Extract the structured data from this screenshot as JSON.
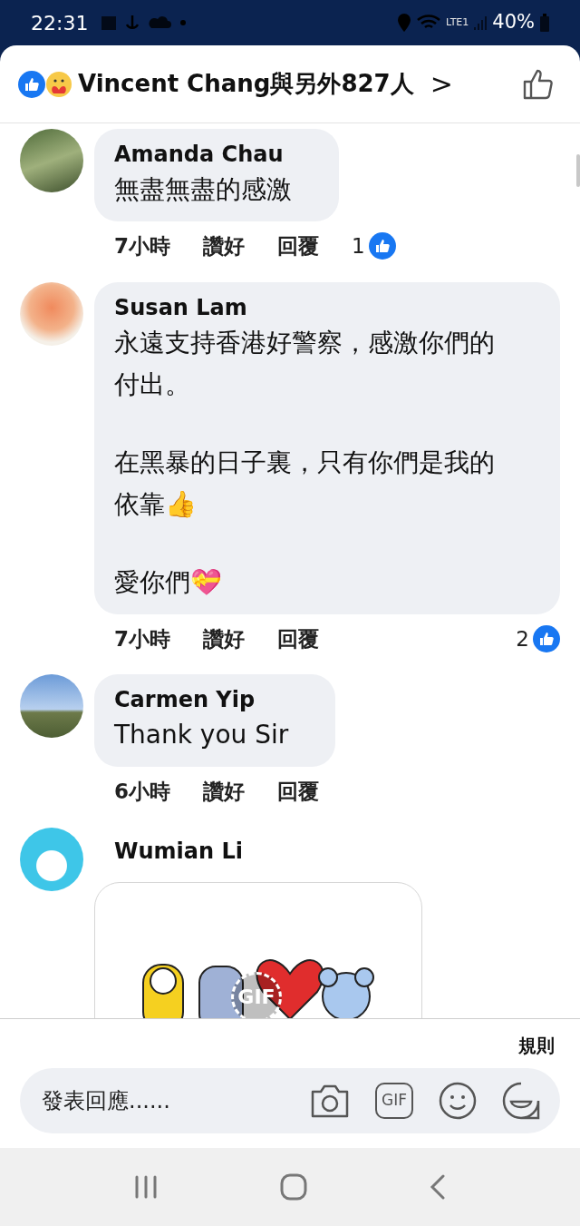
{
  "status_bar": {
    "time": "22:31",
    "network": "LTE1",
    "battery": "40%"
  },
  "header": {
    "title": "Vincent Chang與另外827人",
    "chevron": ">"
  },
  "comments": [
    {
      "author": "Amanda Chau",
      "kind": "text",
      "paragraphs": [
        "無盡無盡的感激"
      ],
      "time": "7小時",
      "like": "讚好",
      "reply": "回覆",
      "reactions": "1"
    },
    {
      "author": "Susan Lam",
      "kind": "text",
      "paragraphs": [
        "永遠支持香港好警察，感激你們的付出。",
        "在黑暴的日子裏，只有你們是我的依靠👍",
        "愛你們💝"
      ],
      "time": "7小時",
      "like": "讚好",
      "reply": "回覆",
      "reactions": "2"
    },
    {
      "author": "Carmen Yip",
      "kind": "text",
      "paragraphs": [
        "Thank you Sir"
      ],
      "time": "6小時",
      "like": "讚好",
      "reply": "回覆"
    },
    {
      "author": "Wumian Li",
      "kind": "gif",
      "gif_label": "GIF"
    }
  ],
  "footer": {
    "rules": "規則",
    "composer": {
      "placeholder": "發表回應......",
      "gif_button": "GIF"
    }
  }
}
